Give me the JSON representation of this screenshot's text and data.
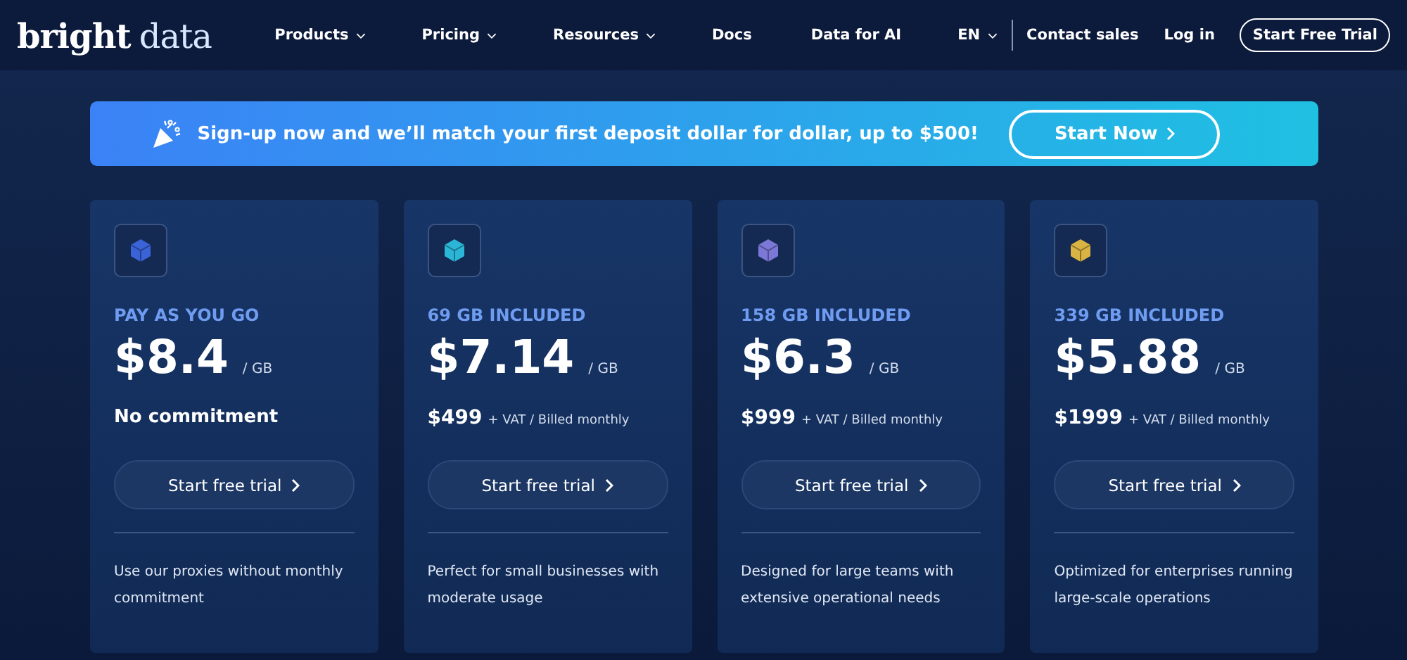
{
  "logo": {
    "brand": "bright",
    "product": "data"
  },
  "nav": [
    {
      "label": "Products",
      "dropdown": true
    },
    {
      "label": "Pricing",
      "dropdown": true
    },
    {
      "label": "Resources",
      "dropdown": true
    },
    {
      "label": "Docs",
      "dropdown": false
    },
    {
      "label": "Data for AI",
      "dropdown": false
    }
  ],
  "language": {
    "label": "EN",
    "dropdown": true
  },
  "header_links": [
    "Contact sales",
    "Log in"
  ],
  "header_button": "Start Free Trial",
  "banner": {
    "text": "Sign-up now and we’ll match your first deposit dollar for dollar, up to $500!",
    "button": "Start Now"
  },
  "plans": [
    {
      "tier": "PAY AS YOU GO",
      "price": "$8.4",
      "unit": "/ GB",
      "kind": "commitment",
      "commitment": "No commitment",
      "color": "#3b63d8",
      "button": "Start free trial",
      "description": "Use our proxies without monthly commitment"
    },
    {
      "tier": "69 GB INCLUDED",
      "price": "$7.14",
      "unit": "/ GB",
      "kind": "billed",
      "amount": "$499",
      "billing": "+ VAT / Billed monthly",
      "color": "#2bb5d6",
      "button": "Start free trial",
      "description": "Perfect for small businesses with moderate usage"
    },
    {
      "tier": "158 GB INCLUDED",
      "price": "$6.3",
      "unit": "/ GB",
      "kind": "billed",
      "amount": "$999",
      "billing": "+ VAT / Billed monthly",
      "color": "#7b78d8",
      "button": "Start free trial",
      "description": "Designed for large teams with extensive operational needs"
    },
    {
      "tier": "339 GB INCLUDED",
      "price": "$5.88",
      "unit": "/ GB",
      "kind": "billed",
      "amount": "$1999",
      "billing": "+ VAT / Billed monthly",
      "color": "#d9b443",
      "button": "Start free trial",
      "description": "Optimized for enterprises running large-scale operations"
    }
  ]
}
